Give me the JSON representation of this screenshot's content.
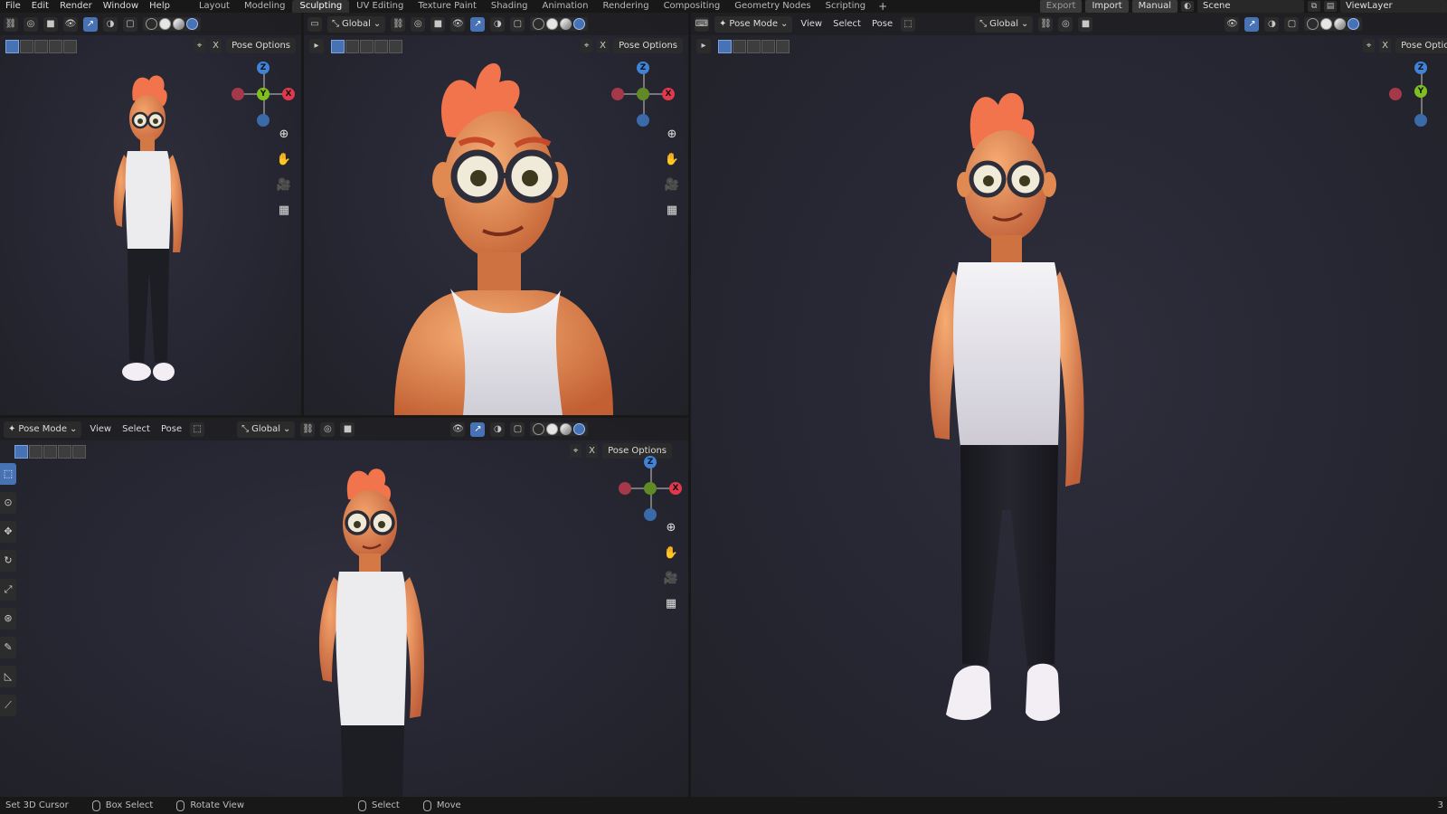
{
  "menu": [
    "File",
    "Edit",
    "Render",
    "Window",
    "Help"
  ],
  "workspace_tabs": [
    {
      "label": "Layout",
      "active": false
    },
    {
      "label": "Modeling",
      "active": false
    },
    {
      "label": "Sculpting",
      "active": true
    },
    {
      "label": "UV Editing",
      "active": false
    },
    {
      "label": "Texture Paint",
      "active": false
    },
    {
      "label": "Shading",
      "active": false
    },
    {
      "label": "Animation",
      "active": false
    },
    {
      "label": "Rendering",
      "active": false
    },
    {
      "label": "Compositing",
      "active": false
    },
    {
      "label": "Geometry Nodes",
      "active": false
    },
    {
      "label": "Scripting",
      "active": false
    }
  ],
  "topbar_right": {
    "export_label": "Export",
    "import_label": "Import",
    "manual_label": "Manual",
    "scene_name": "Scene",
    "view_layer": "ViewLayer"
  },
  "viewport_header": {
    "mode": "Pose Mode",
    "menus": [
      "View",
      "Select",
      "Pose"
    ],
    "orientation": "Global",
    "pose_options": "Pose Options"
  },
  "gizmo": {
    "z": "Z",
    "x": "X",
    "y": "Y"
  },
  "statusbar": {
    "items": [
      "Set 3D Cursor",
      "Box Select",
      "Rotate View",
      "Select",
      "Move"
    ],
    "count": "3"
  },
  "colors": {
    "accent": "#4772b3",
    "axis_x": "#e2384e",
    "axis_y": "#7fc020",
    "axis_z": "#3f83d8",
    "skin": "#e08a52",
    "hair": "#f0704a",
    "shirt": "#ecebee",
    "pants": "#1d1d24"
  }
}
